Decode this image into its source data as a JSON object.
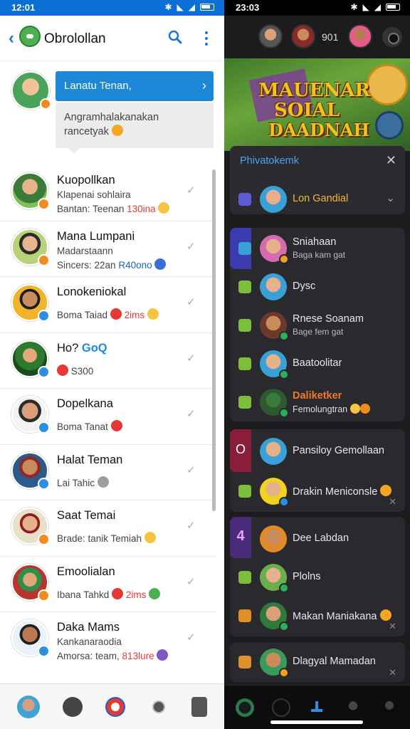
{
  "left": {
    "status": {
      "time": "12:01"
    },
    "appbar": {
      "title": "Obrolollan"
    },
    "pinned": {
      "header": "Lanatu Tenan,",
      "message": "Angramhalakanakan rancetyak"
    },
    "chats": [
      {
        "name": "Kuopollkan",
        "line1": "Klapenai sohlaira",
        "line2_text": "Bantan: Teenan",
        "line2_accent": "130ina",
        "accent_color": "#e53935"
      },
      {
        "name": "Mana Lumpani",
        "line1": "Madarstaann",
        "line2_text": "Sincers: 22an",
        "line2_accent": "R40ono",
        "accent_color": "#1565c0"
      },
      {
        "name": "Lonokeniokal",
        "line1": "",
        "line2_text": "Boma Taiad",
        "line2_accent": "2ims",
        "accent_color": "#e53935"
      },
      {
        "name_pre": "Ho?",
        "name_hl": "GoQ",
        "line1": "",
        "line2_text": "S300",
        "line2_accent": "",
        "accent_color": "#e53935"
      },
      {
        "name": "Dopelkana",
        "line1": "",
        "line2_text": "Boma Tanat",
        "line2_accent": "",
        "accent_color": "#e53935"
      },
      {
        "name": "Halat Teman",
        "line1": "",
        "line2_text": "Lai Tahic",
        "line2_accent": "",
        "accent_color": "#e53935"
      },
      {
        "name": "Saat Temai",
        "line1": "",
        "line2_text": "Brade: tanik Temiah",
        "line2_accent": "",
        "accent_color": "#e53935"
      },
      {
        "name": "Emoolialan",
        "line1": "",
        "line2_text": "Ibana Tahkd",
        "line2_accent": "2ims",
        "accent_color": "#e53935"
      },
      {
        "name": "Daka Mams",
        "line1": "Kankanaraodia",
        "line2_text": "Amorsa: team,",
        "line2_accent": "813lure",
        "accent_color": "#e53935"
      }
    ]
  },
  "right": {
    "status": {
      "time": "23:03"
    },
    "topbar": {
      "count": "901"
    },
    "banner": {
      "line1": "MAUENAR",
      "line2": "SOIAL",
      "line3": "DAADNAH"
    },
    "panel": {
      "title": "Phivatokemk"
    },
    "panel_item": {
      "name": "Lon Gandial"
    },
    "group1": [
      {
        "name": "Sniahaan",
        "sub": "Baga kam gat"
      },
      {
        "name": "Dysc",
        "sub": ""
      },
      {
        "name": "Rnese Soanam",
        "sub": "Bage fem gat"
      },
      {
        "name": "Baatoolitar",
        "sub": ""
      },
      {
        "name": "Daliketker",
        "sub": "Femolungtran",
        "hl": true
      }
    ],
    "group2": [
      {
        "name": "Pansiloy Gemollaan"
      },
      {
        "name": "Drakin Meniconsle"
      }
    ],
    "group3": [
      {
        "name": "Dee Labdan"
      },
      {
        "name": "Plolns"
      },
      {
        "name": "Makan Maniakana"
      }
    ],
    "group4": [
      {
        "name": "Dlagyal Mamadan"
      }
    ],
    "tag_letters": {
      "g2": "O",
      "g3": "4"
    }
  }
}
